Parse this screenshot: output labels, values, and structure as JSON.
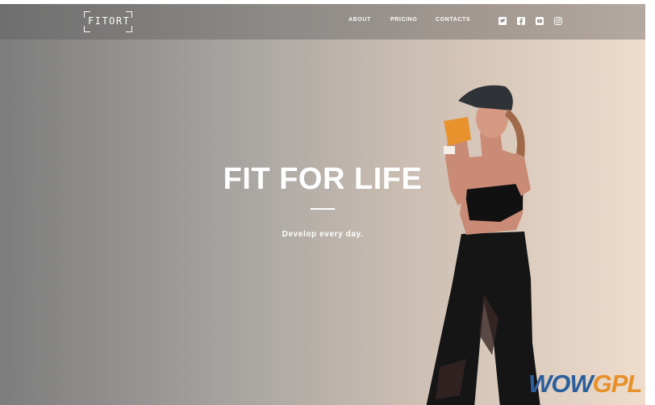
{
  "brand": {
    "logo_text": "FITORT"
  },
  "nav": {
    "links": [
      {
        "label": "ABOUT"
      },
      {
        "label": "PRICING"
      },
      {
        "label": "CONTACTS"
      }
    ],
    "social_icons": [
      "twitter-icon",
      "facebook-icon",
      "youtube-icon",
      "instagram-icon"
    ]
  },
  "hero": {
    "title": "FIT FOR LIFE",
    "subtitle": "Develop every day."
  },
  "watermark": {
    "part1": "WOW",
    "part2": "GPL"
  },
  "colors": {
    "gradient_left": "#7d7d7d",
    "gradient_right": "#eedccc",
    "text": "#ffffff",
    "watermark_blue": "#2c5f9e",
    "watermark_orange": "#e8902a"
  }
}
